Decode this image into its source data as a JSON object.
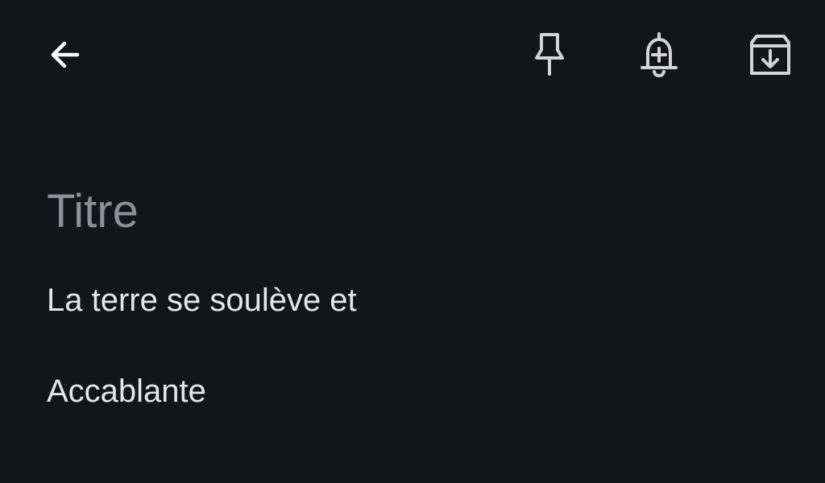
{
  "toolbar": {
    "back_icon": "arrow-left-icon",
    "pin_icon": "pin-icon",
    "reminder_icon": "bell-plus-icon",
    "archive_icon": "archive-download-icon"
  },
  "note": {
    "title_placeholder": "Titre",
    "body_lines": [
      "La terre se soulève et",
      "Accablante"
    ]
  },
  "colors": {
    "background": "#141519",
    "icon": "#d3d3d8",
    "title_placeholder": "#8e9096",
    "body_text": "#e6e6ea"
  }
}
